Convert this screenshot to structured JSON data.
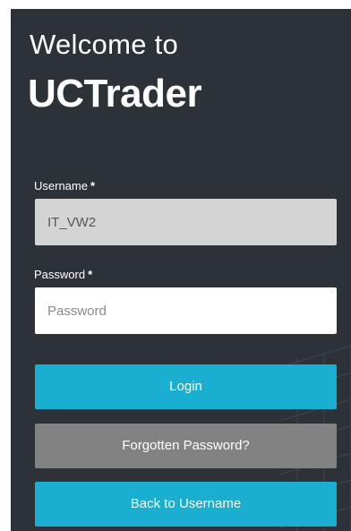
{
  "header": {
    "welcome": "Welcome to",
    "brand": "UCTrader"
  },
  "username": {
    "label": "Username",
    "required": "*",
    "value": "IT_VW2"
  },
  "password": {
    "label": "Password",
    "required": "*",
    "placeholder": "Password"
  },
  "buttons": {
    "login": "Login",
    "forgot": "Forgotten Password?",
    "back": "Back to Username"
  },
  "colors": {
    "panel_bg": "#2d3138",
    "accent": "#1aaed0",
    "secondary": "#828282"
  }
}
